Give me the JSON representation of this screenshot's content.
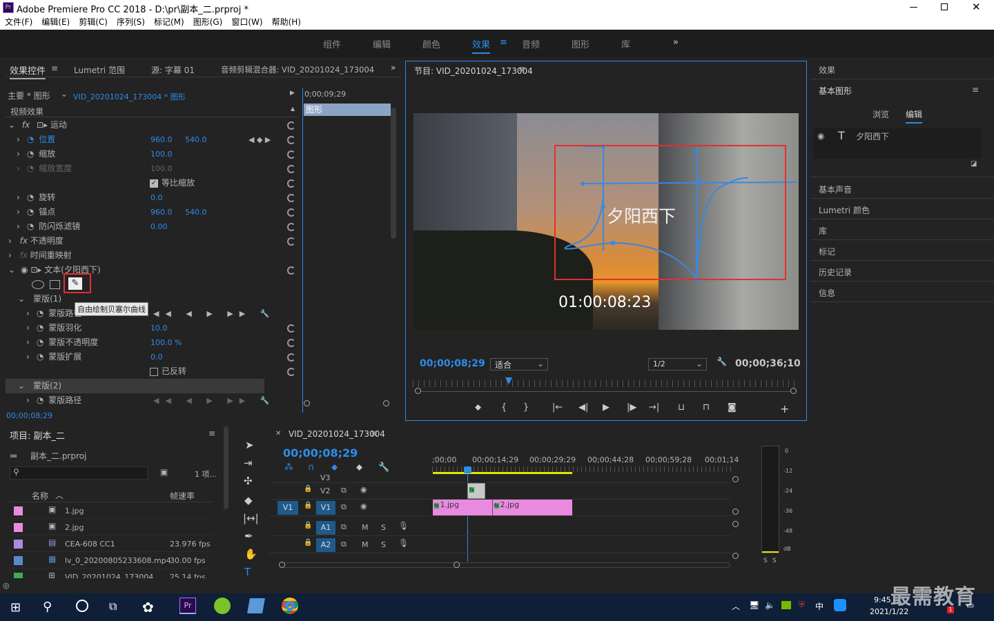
{
  "titlebar": {
    "title": "Adobe Premiere Pro CC 2018 - D:\\pr\\副本_二.prproj *",
    "app_icon": "Pr"
  },
  "menu": [
    "文件(F)",
    "编辑(E)",
    "剪辑(C)",
    "序列(S)",
    "标记(M)",
    "图形(G)",
    "窗口(W)",
    "帮助(H)"
  ],
  "workspaces": [
    "组件",
    "编辑",
    "颜色",
    "效果",
    "音频",
    "图形",
    "库"
  ],
  "active_workspace": "效果",
  "effect_controls": {
    "tabs": [
      "效果控件",
      "Lumetri 范围",
      "源: 字幕 01",
      "音频剪辑混合器: VID_20201024_173004"
    ],
    "master": "主要 * 图形",
    "clip": "VID_20201024_173004 * 图形",
    "timecode_top": "0;00;09;29",
    "clip_bar": "图形",
    "section": "视频效果",
    "rows": [
      {
        "label": "运动",
        "fx": "fx"
      },
      {
        "label": "位置",
        "v1": "960.0",
        "v2": "540.0"
      },
      {
        "label": "缩放",
        "v1": "100.0"
      },
      {
        "label": "缩放宽度",
        "v1": "100.0"
      },
      {
        "label": "等比缩放"
      },
      {
        "label": "旋转",
        "v1": "0.0"
      },
      {
        "label": "锚点",
        "v1": "960.0",
        "v2": "540.0"
      },
      {
        "label": "防闪烁滤镜",
        "v1": "0.00"
      },
      {
        "label": "不透明度"
      },
      {
        "label": "时间重映射"
      },
      {
        "label": "文本(夕阳西下)"
      },
      {
        "label": "蒙版(1)"
      },
      {
        "label": "蒙版路径"
      },
      {
        "label": "蒙版羽化",
        "v1": "10.0"
      },
      {
        "label": "蒙版不透明度",
        "v1": "100.0 %"
      },
      {
        "label": "蒙版扩展",
        "v1": "0.0"
      },
      {
        "label": "已反转"
      },
      {
        "label": "蒙版(2)"
      },
      {
        "label": "蒙版路径"
      }
    ],
    "tooltip": "自由绘制贝塞尔曲线",
    "bottom_timecode": "00;00;08;29"
  },
  "program": {
    "title": "节目: VID_20201024_173004",
    "overlay_text": "夕阳西下",
    "video_timecode": "01:00:08:23",
    "current": "00;00;08;29",
    "fit": "适合",
    "quality": "1/2",
    "duration": "00;00;36;10"
  },
  "right_panel": {
    "effects": "效果",
    "essential_graphics": "基本图形",
    "tabs": [
      "浏览",
      "编辑"
    ],
    "layer": "夕阳西下",
    "items": [
      "基本声音",
      "Lumetri 颜色",
      "库",
      "标记",
      "历史记录",
      "信息"
    ]
  },
  "project": {
    "title": "项目: 副本_二",
    "file": "副本_二.prproj",
    "count": "1 项...",
    "col_name": "名称",
    "col_fps": "帧速率",
    "items": [
      {
        "name": "1.jpg",
        "fps": "",
        "color": "#e88be0"
      },
      {
        "name": "2.jpg",
        "fps": "",
        "color": "#e88be0"
      },
      {
        "name": "CEA-608 CC1",
        "fps": "23.976 fps",
        "color": "#a98be0"
      },
      {
        "name": "lv_0_20200805233608.mp4",
        "fps": "30.00 fps",
        "color": "#5a8bc8"
      },
      {
        "name": "VID_20201024_173004",
        "fps": "25.14 fps",
        "color": "#3dab54"
      }
    ]
  },
  "timeline": {
    "title": "VID_20201024_173004",
    "timecode": "00;00;08;29",
    "ruler": [
      ";00;00",
      "00;00;14;29",
      "00;00;29;29",
      "00;00;44;28",
      "00;00;59;28",
      "00;01;14"
    ],
    "tracks": [
      "V3",
      "V2",
      "V1",
      "A1",
      "A2"
    ],
    "source_patch": "V1",
    "clips": [
      {
        "name": "1.jpg"
      },
      {
        "name": "2.jpg"
      }
    ]
  },
  "meter": {
    "labels": [
      "0",
      "-12",
      "-24",
      "-36",
      "-48",
      "dB"
    ],
    "solo": [
      "S",
      "S"
    ]
  },
  "taskbar": {
    "time": "9:45",
    "date": "2021/1/22",
    "ime": "中",
    "watermark": "最需教育",
    "badge": "1"
  }
}
